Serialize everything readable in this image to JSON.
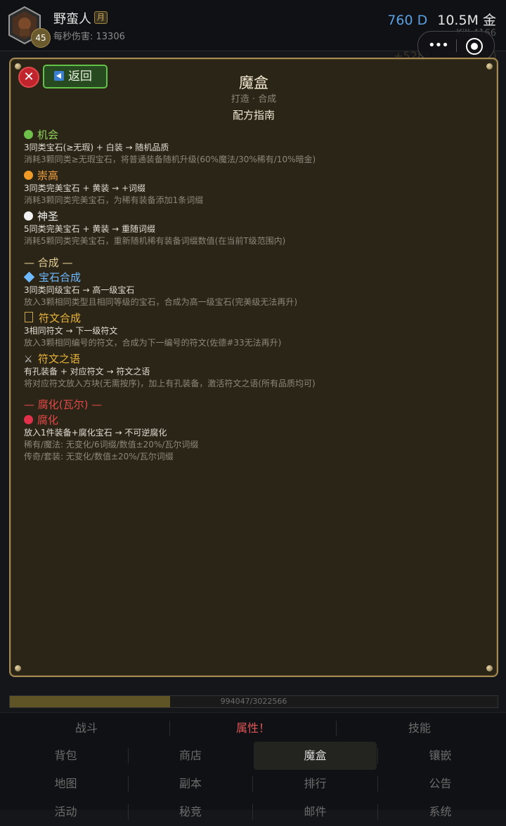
{
  "player": {
    "name": "野蛮人",
    "badge": "月",
    "level": "45",
    "dps": "每秒伤害: 13306"
  },
  "currency": {
    "d": "760 D",
    "gold": "10.5M 金"
  },
  "kill_text": "Kill:4166",
  "bg_texts": [
    "+528K金(自动出售)"
  ],
  "miniapp": {
    "menu_icon": "more-dots-icon",
    "close_icon": "target-icon"
  },
  "modal": {
    "title": "魔盒",
    "subtitle": "打造 · 合成",
    "heading": "配方指南",
    "back_label": "返回",
    "close_symbol": "✕",
    "recipes": [
      {
        "title": "机会",
        "color": "#8fd15a",
        "dot": "#6fc04a",
        "line": "3同类宝石(≥无瑕) + 白装 → 随机品质",
        "desc": "消耗3颗同类≥无瑕宝石，将普通装备随机升级(60%魔法/30%稀有/10%暗金)"
      },
      {
        "title": "崇高",
        "color": "#f0a040",
        "dot": "#f09a28",
        "line": "3同类完美宝石 + 黄装 → +词缀",
        "desc": "消耗3颗同类完美宝石，为稀有装备添加1条词缀"
      },
      {
        "title": "神圣",
        "color": "#f0f0f0",
        "dot": "#f2f2f2",
        "line": "5同类完美宝石 + 黄装 → 重随词缀",
        "desc": "消耗5颗同类完美宝石，重新随机稀有装备词缀数值(在当前T级范围内)"
      }
    ],
    "combine_header": "— 合成 —",
    "combine": [
      {
        "title": "宝石合成",
        "color": "#6fb9ff",
        "icon": "gem-icon",
        "line": "3同类同级宝石 → 高一级宝石",
        "desc": "放入3颗相同类型且相同等级的宝石，合成为高一级宝石(完美级无法再升)"
      },
      {
        "title": "符文合成",
        "color": "#e6b23a",
        "icon": "rune-icon",
        "line": "3相同符文 → 下一级符文",
        "desc": "放入3颗相同编号的符文，合成为下一编号的符文(佐德#33无法再升)"
      },
      {
        "title": "符文之语",
        "color": "#e6b23a",
        "icon": "crossed-swords-icon",
        "line": "有孔装备 + 对应符文 → 符文之语",
        "desc": "将对应符文放入方块(无需按序)，加上有孔装备，激活符文之语(所有品质均可)"
      }
    ],
    "corrupt_header": "— 腐化(瓦尔) —",
    "corrupt": {
      "title": "腐化",
      "color": "#e54848",
      "dot": "#e0304a",
      "line": "放入1件装备+腐化宝石 → 不可逆腐化",
      "desc1": "稀有/魔法: 无变化/6词缀/数值±20%/瓦尔词缀",
      "desc2": "传奇/套装: 无变化/数值±20%/瓦尔词缀"
    }
  },
  "xp": {
    "current": 994047,
    "max": 3022566,
    "text": "994047/3022566"
  },
  "nav": {
    "row1": [
      "战斗",
      "属性！",
      "技能"
    ],
    "row2": [
      "背包",
      "商店",
      "魔盒",
      "镶嵌"
    ],
    "row3": [
      "地图",
      "副本",
      "排行",
      "公告"
    ],
    "row4": [
      "活动",
      "秘竞",
      "邮件",
      "系统"
    ]
  },
  "colors": {
    "accent_gold": "#a48a52",
    "back_green": "#63c24a",
    "close_red": "#c0242c"
  }
}
